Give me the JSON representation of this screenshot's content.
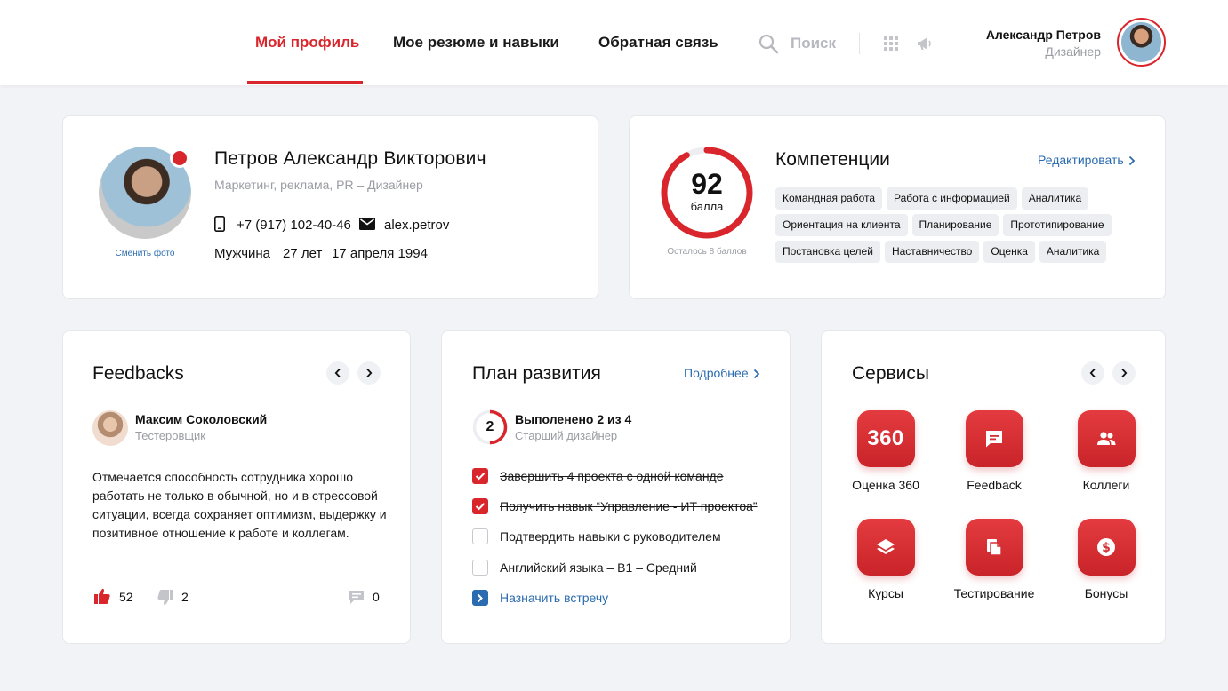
{
  "header": {
    "tabs": [
      {
        "label": "Мой профиль",
        "active": true
      },
      {
        "label": "Мое резюме и навыки",
        "active": false
      },
      {
        "label": "Обратная связь",
        "active": false
      }
    ],
    "search_placeholder": "Поиск",
    "user_name": "Александр Петров",
    "user_role": "Дизайнер",
    "icons": [
      "search-icon",
      "apps-grid-icon",
      "megaphone-icon"
    ]
  },
  "profile": {
    "full_name": "Петров Александр Викторович",
    "subtitle": "Маркетинг, реклама, PR – Дизайнер",
    "change_photo": "Сменить фото",
    "phone": "+7 (917) 102-40-46",
    "email": "alex.petrov",
    "gender": "Мужчина",
    "age": "27 лет",
    "birth_date": "17 апреля 1994"
  },
  "competencies": {
    "score": 92,
    "score_max": 100,
    "score_unit": "балла",
    "remaining": "Осталось 8 баллов",
    "title": "Компетенции",
    "edit_label": "Редактировать",
    "chip_rows": [
      [
        "Командная работа",
        "Работа с информацией",
        "Аналитика"
      ],
      [
        "Ориентация на клиента",
        "Планирование",
        "Прототипирование"
      ],
      [
        "Постановка целей",
        "Наставничество",
        "Оценка",
        "Аналитика"
      ]
    ]
  },
  "feedbacks": {
    "title": "Feedbacks",
    "author_name": "Максим Соколовский",
    "author_role": "Тестеровщик",
    "text": "Отмечается способность сотрудника хорошо работать не только в обычной, но и в стрессовой ситуации, всегда сохраняет оптимизм, выдержку и позитивное отношение к работе и коллегам.",
    "likes": "52",
    "dislikes": "2",
    "comments": "0"
  },
  "plan": {
    "title": "План развития",
    "more_label": "Подробнее",
    "progress_done": 2,
    "progress_total": 4,
    "progress_number": "2",
    "status": "Выполенено 2 из 4",
    "position": "Старший дизайнер",
    "tasks": [
      {
        "label": "Завершить 4 проекта с одной команде",
        "done": true
      },
      {
        "label": "Получить навык “Управление - ИТ проектоа”",
        "done": true
      },
      {
        "label": "Подтвердить навыки с руководителем",
        "done": false
      },
      {
        "label": "Английский языка – B1 – Средний",
        "done": false
      }
    ],
    "meeting_label": "Назначить встречу"
  },
  "services": {
    "title": "Сервисы",
    "items": [
      {
        "label": "Оценка 360",
        "icon": "360-badge",
        "badge_text": "360"
      },
      {
        "label": "Feedback",
        "icon": "chat-bubble-icon"
      },
      {
        "label": "Коллеги",
        "icon": "people-icon"
      },
      {
        "label": "Курсы",
        "icon": "layers-icon"
      },
      {
        "label": "Тестирование",
        "icon": "documents-icon"
      },
      {
        "label": "Бонусы",
        "icon": "dollar-coin-icon"
      }
    ]
  },
  "colors": {
    "accent": "#d9262c",
    "link": "#2b6cb0",
    "muted": "#9a9ca3",
    "background": "#f2f3f6",
    "chip": "#eceef1"
  }
}
